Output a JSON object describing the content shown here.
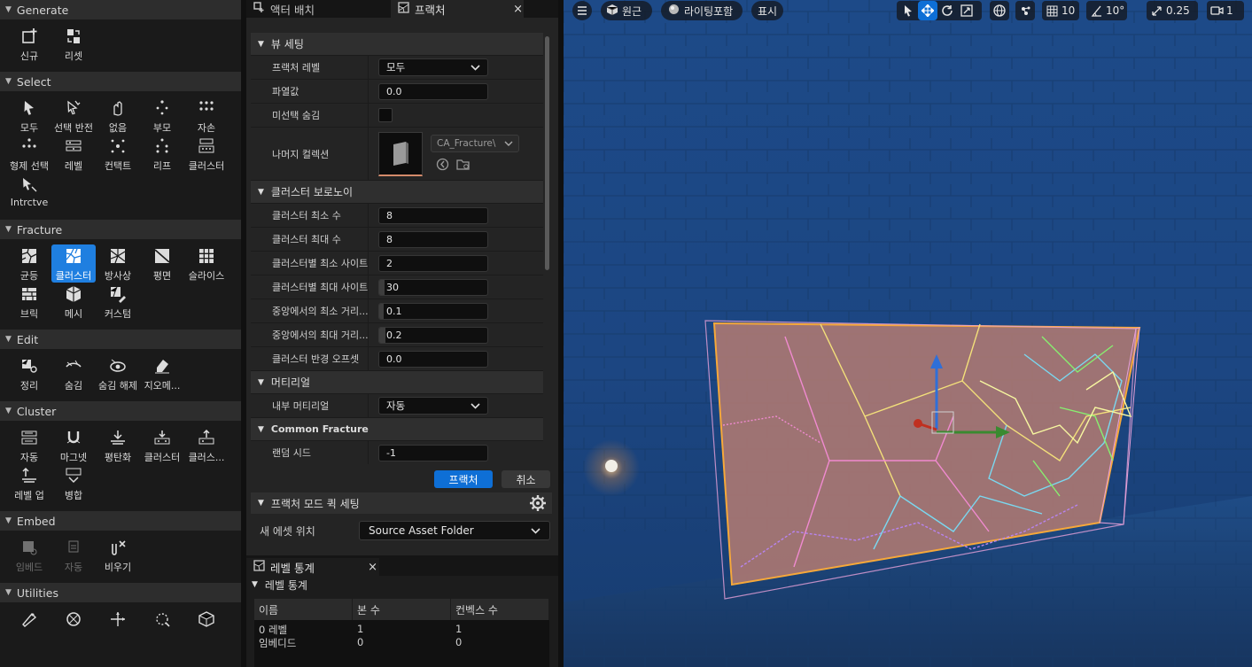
{
  "palette": {
    "sections": [
      {
        "title": "Generate",
        "tools": [
          {
            "label": "신규",
            "icon": "new-icon",
            "active": false,
            "dim": false
          },
          {
            "label": "리셋",
            "icon": "reset-icon",
            "active": false,
            "dim": false
          }
        ]
      },
      {
        "title": "Select",
        "tools": [
          {
            "label": "모두",
            "icon": "select-all-icon",
            "active": false,
            "dim": false
          },
          {
            "label": "선택 반전",
            "icon": "invert-selection-icon",
            "active": false,
            "dim": false
          },
          {
            "label": "없음",
            "icon": "select-none-icon",
            "active": false,
            "dim": false
          },
          {
            "label": "부모",
            "icon": "parent-icon",
            "active": false,
            "dim": false
          },
          {
            "label": "자손",
            "icon": "children-icon",
            "active": false,
            "dim": false
          },
          {
            "label": "형제 선택",
            "icon": "siblings-icon",
            "active": false,
            "dim": false
          },
          {
            "label": "레벨",
            "icon": "level-icon",
            "active": false,
            "dim": false
          },
          {
            "label": "컨택트",
            "icon": "contact-icon",
            "active": false,
            "dim": false
          },
          {
            "label": "리프",
            "icon": "leaf-icon",
            "active": false,
            "dim": false
          },
          {
            "label": "클러스터",
            "icon": "cluster-select-icon",
            "active": false,
            "dim": false
          },
          {
            "label": "Intrctve",
            "icon": "interactive-icon",
            "active": false,
            "dim": false
          }
        ]
      },
      {
        "title": "Fracture",
        "tools": [
          {
            "label": "균등",
            "icon": "uniform-icon",
            "active": false,
            "dim": false
          },
          {
            "label": "클러스터",
            "icon": "cluster-fracture-icon",
            "active": true,
            "dim": false
          },
          {
            "label": "방사상",
            "icon": "radial-icon",
            "active": false,
            "dim": false
          },
          {
            "label": "평면",
            "icon": "planar-icon",
            "active": false,
            "dim": false
          },
          {
            "label": "슬라이스",
            "icon": "slice-icon",
            "active": false,
            "dim": false
          },
          {
            "label": "브릭",
            "icon": "brick-icon",
            "active": false,
            "dim": false
          },
          {
            "label": "메시",
            "icon": "mesh-icon",
            "active": false,
            "dim": false
          },
          {
            "label": "커스텀",
            "icon": "custom-icon",
            "active": false,
            "dim": false
          }
        ]
      },
      {
        "title": "Edit",
        "tools": [
          {
            "label": "정리",
            "icon": "tidy-icon",
            "active": false,
            "dim": false
          },
          {
            "label": "숨김",
            "icon": "hide-icon",
            "active": false,
            "dim": false
          },
          {
            "label": "숨김 해제",
            "icon": "unhide-icon",
            "active": false,
            "dim": false
          },
          {
            "label": "지오메...",
            "icon": "eraser-icon",
            "active": false,
            "dim": false
          }
        ]
      },
      {
        "title": "Cluster",
        "tools": [
          {
            "label": "자동",
            "icon": "auto-cluster-icon",
            "active": false,
            "dim": false
          },
          {
            "label": "마그넷",
            "icon": "magnet-icon",
            "active": false,
            "dim": false
          },
          {
            "label": "평탄화",
            "icon": "flatten-icon",
            "active": false,
            "dim": false
          },
          {
            "label": "클러스터",
            "icon": "cluster-down-icon",
            "active": false,
            "dim": false
          },
          {
            "label": "클러스...",
            "icon": "cluster-up-icon",
            "active": false,
            "dim": false
          },
          {
            "label": "레벨 업",
            "icon": "level-up-icon",
            "active": false,
            "dim": false
          },
          {
            "label": "병합",
            "icon": "merge-icon",
            "active": false,
            "dim": false
          }
        ]
      },
      {
        "title": "Embed",
        "tools": [
          {
            "label": "임베드",
            "icon": "embed-icon",
            "active": false,
            "dim": true
          },
          {
            "label": "자동",
            "icon": "auto-embed-icon",
            "active": false,
            "dim": true
          },
          {
            "label": "비우기",
            "icon": "clear-icon",
            "active": false,
            "dim": false
          }
        ]
      },
      {
        "title": "Utilities",
        "tools": [
          {
            "label": "",
            "icon": "utility-1-icon",
            "active": false,
            "dim": false
          },
          {
            "label": "",
            "icon": "utility-2-icon",
            "active": false,
            "dim": false
          },
          {
            "label": "",
            "icon": "utility-3-icon",
            "active": false,
            "dim": false
          },
          {
            "label": "",
            "icon": "utility-4-icon",
            "active": false,
            "dim": false
          },
          {
            "label": "",
            "icon": "utility-5-icon",
            "active": false,
            "dim": false
          }
        ]
      }
    ]
  },
  "details": {
    "tabs": [
      {
        "label": "액터 배치",
        "icon": "place-actors-icon"
      },
      {
        "label": "프랙처",
        "icon": "fracture-tab-icon"
      }
    ],
    "close": "×",
    "categories": [
      {
        "title": "뷰 세팅",
        "small": false,
        "rows": [
          {
            "name": "프랙처 레벨",
            "kind": "dropdown",
            "value": "모두"
          },
          {
            "name": "파열값",
            "kind": "number",
            "value": "0.0",
            "fill": 0
          },
          {
            "name": "미선택 숨김",
            "kind": "check",
            "value": ""
          },
          {
            "name": "나머지 컬렉션",
            "kind": "asset",
            "value": "CA_Fracture\\"
          }
        ]
      },
      {
        "title": "클러스터 보로노이",
        "small": false,
        "rows": [
          {
            "name": "클러스터 최소 수",
            "kind": "number",
            "value": "8",
            "fill": 0
          },
          {
            "name": "클러스터 최대 수",
            "kind": "number",
            "value": "8",
            "fill": 0
          },
          {
            "name": "클러스터별 최소 사이트",
            "kind": "number",
            "value": "2",
            "fill": 0
          },
          {
            "name": "클러스터별 최대 사이트",
            "kind": "number",
            "value": "30",
            "fill": 0.05
          },
          {
            "name": "중앙에서의 최소 거리...",
            "kind": "number",
            "value": "0.1",
            "fill": 0.04
          },
          {
            "name": "중앙에서의 최대 거리...",
            "kind": "number",
            "value": "0.2",
            "fill": 0.06
          },
          {
            "name": "클러스터 반경 오프셋",
            "kind": "number",
            "value": "0.0",
            "fill": 0
          }
        ]
      },
      {
        "title": "머티리얼",
        "small": false,
        "rows": [
          {
            "name": "내부 머티리얼",
            "kind": "dropdown",
            "value": "자동"
          }
        ]
      },
      {
        "title": "Common Fracture",
        "small": true,
        "rows": [
          {
            "name": "랜덤 시드",
            "kind": "number",
            "value": "-1",
            "fill": 0
          }
        ]
      }
    ],
    "fracture_button": "프랙처",
    "cancel_button": "취소",
    "quick_settings": {
      "title": "프랙처 모드 퀵 세팅",
      "asset_location_label": "새 에셋 위치",
      "asset_location_value": "Source Asset Folder"
    }
  },
  "stats": {
    "tab": "레벨 통계",
    "close": "×",
    "header": "레벨 통계",
    "columns": [
      "이름",
      "본 수",
      "컨벡스 수"
    ],
    "rows": [
      [
        "0 레벨",
        "1",
        "1"
      ],
      [
        "임베디드",
        "0",
        "0"
      ]
    ]
  },
  "viewport": {
    "menu_icon": "hamburger-icon",
    "perspective": "원근",
    "lighting": "라이팅포함",
    "show": "표시",
    "grid_snap": "10",
    "rotation_snap": "10°",
    "scale_snap": "0.25",
    "camera_speed": "1"
  }
}
